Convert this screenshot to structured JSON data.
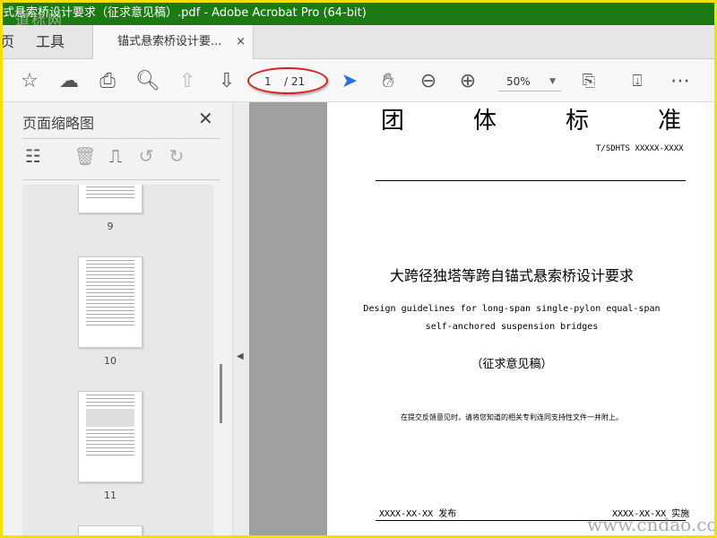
{
  "window": {
    "title": "式悬索桥设计要求（征求意见稿）.pdf - Adobe Acrobat Pro (64-bit)",
    "watermark_top": "道标网",
    "watermark_bottom": "www.cndao.com"
  },
  "tabs": {
    "home": "页",
    "tools": "工具",
    "document": "锚式悬索桥设计要...",
    "close": "×"
  },
  "toolbar": {
    "page_current": "1",
    "page_total": "/ 21",
    "zoom": "50%"
  },
  "panel": {
    "title": "页面缩略图",
    "close": "✕",
    "thumbnails": [
      {
        "label": "9"
      },
      {
        "label": "10"
      },
      {
        "label": "11"
      }
    ]
  },
  "document": {
    "header_chars": [
      "团",
      "体",
      "标",
      "准"
    ],
    "code": "T/SDHTS XXXXX-XXXX",
    "title_cn": "大跨径独塔等跨自锚式悬索桥设计要求",
    "title_en_1": "Design guidelines for long-span single-pylon equal-span",
    "title_en_2": "self-anchored suspension bridges",
    "draft": "（征求意见稿）",
    "notice": "在提交反馈意见时，请将您知道的相关专利连同支持性文件一并附上。",
    "publish": "XXXX-XX-XX 发布",
    "implement": "XXXX-XX-XX 实施"
  }
}
